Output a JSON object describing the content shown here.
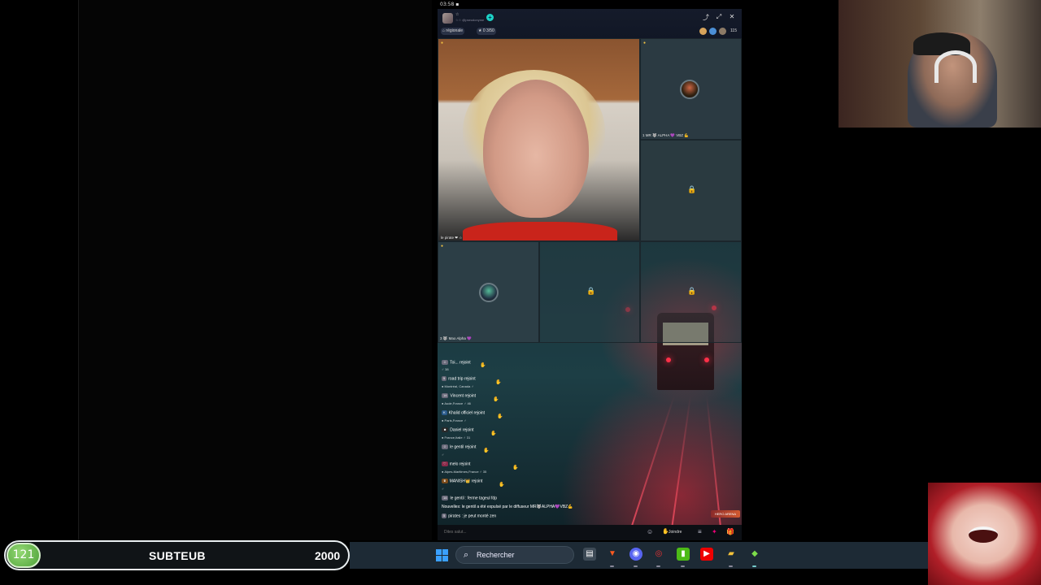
{
  "status_bar": {
    "time": "03:58"
  },
  "header": {
    "host_name": "☆",
    "host_sub": "☆☆ @pseudonyme",
    "follow_symbol": "+",
    "region_tag": "régionale",
    "goal_tag": "0 3/50",
    "viewer_count": "115",
    "controls": [
      "share-icon",
      "expand-icon",
      "close-icon"
    ]
  },
  "grid": {
    "main_cell_label": "le pirate ❤ ☆",
    "guest1_label": "MR 🐺 ALPHA 💜 VBZ 💪",
    "guest1_num": "1",
    "guest2_label": "🐺 Mao Alpha 💜",
    "guest2_num": "3"
  },
  "chat": {
    "rows": [
      {
        "name": "Toi...",
        "action": "rejoint",
        "loc": "♂ 38"
      },
      {
        "name": "road trip",
        "action": "rejoint",
        "loc": "Montréal, Canada",
        "badge": "♂"
      },
      {
        "name": "Vincent",
        "action": "rejoint",
        "loc": "Aude,France",
        "badge": "♂ 46"
      },
      {
        "name": "Khalid officiel",
        "action": "rejoint",
        "loc": "Paris,France",
        "badge": "♂"
      },
      {
        "name": "Daniel",
        "action": "rejoint",
        "loc": "France,Italie",
        "badge": "♂ 31"
      },
      {
        "name": "le gentil",
        "action": "rejoint",
        "loc": "♂"
      },
      {
        "name": "melo",
        "action": "rejoint",
        "loc": "Alpes-Maritimes,France",
        "badge": "♂ 35"
      },
      {
        "name": "MANISH👑",
        "action": "rejoint",
        "loc": "♂"
      }
    ],
    "message1": "le gentil : ferme tageul fdp",
    "system_msg": "Nouvelles: le gentil a été expulsé par le diffuseur MR🐺ALPHA💜VBZ💪",
    "message2": "pirates : je peut monté zen",
    "arena_label": "HERO ARENA",
    "input_placeholder": "Dites salut...",
    "join_label": "Joindre"
  },
  "subgoal": {
    "count": "121",
    "name": "SUBTEUB",
    "target": "2000"
  },
  "taskbar": {
    "search_label": "Rechercher",
    "apps": [
      "file-explorer-icon",
      "brave-icon",
      "discord-icon",
      "chrome-icon",
      "spotify-icon",
      "youtube-icon",
      "folder-icon",
      "streamlabs-icon"
    ]
  },
  "colors": {
    "accent": "#1dd3c6",
    "goal_green": "#4fa23a",
    "taskbar": "#1d2a35"
  }
}
